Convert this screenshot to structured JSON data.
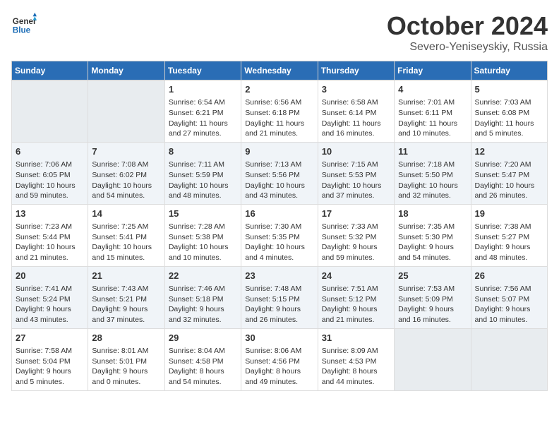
{
  "header": {
    "logo_line1": "General",
    "logo_line2": "Blue",
    "month": "October 2024",
    "location": "Severo-Yeniseyskiy, Russia"
  },
  "columns": [
    "Sunday",
    "Monday",
    "Tuesday",
    "Wednesday",
    "Thursday",
    "Friday",
    "Saturday"
  ],
  "weeks": [
    {
      "days": [
        {
          "number": "",
          "info": ""
        },
        {
          "number": "",
          "info": ""
        },
        {
          "number": "1",
          "info": "Sunrise: 6:54 AM\nSunset: 6:21 PM\nDaylight: 11 hours\nand 27 minutes."
        },
        {
          "number": "2",
          "info": "Sunrise: 6:56 AM\nSunset: 6:18 PM\nDaylight: 11 hours\nand 21 minutes."
        },
        {
          "number": "3",
          "info": "Sunrise: 6:58 AM\nSunset: 6:14 PM\nDaylight: 11 hours\nand 16 minutes."
        },
        {
          "number": "4",
          "info": "Sunrise: 7:01 AM\nSunset: 6:11 PM\nDaylight: 11 hours\nand 10 minutes."
        },
        {
          "number": "5",
          "info": "Sunrise: 7:03 AM\nSunset: 6:08 PM\nDaylight: 11 hours\nand 5 minutes."
        }
      ]
    },
    {
      "days": [
        {
          "number": "6",
          "info": "Sunrise: 7:06 AM\nSunset: 6:05 PM\nDaylight: 10 hours\nand 59 minutes."
        },
        {
          "number": "7",
          "info": "Sunrise: 7:08 AM\nSunset: 6:02 PM\nDaylight: 10 hours\nand 54 minutes."
        },
        {
          "number": "8",
          "info": "Sunrise: 7:11 AM\nSunset: 5:59 PM\nDaylight: 10 hours\nand 48 minutes."
        },
        {
          "number": "9",
          "info": "Sunrise: 7:13 AM\nSunset: 5:56 PM\nDaylight: 10 hours\nand 43 minutes."
        },
        {
          "number": "10",
          "info": "Sunrise: 7:15 AM\nSunset: 5:53 PM\nDaylight: 10 hours\nand 37 minutes."
        },
        {
          "number": "11",
          "info": "Sunrise: 7:18 AM\nSunset: 5:50 PM\nDaylight: 10 hours\nand 32 minutes."
        },
        {
          "number": "12",
          "info": "Sunrise: 7:20 AM\nSunset: 5:47 PM\nDaylight: 10 hours\nand 26 minutes."
        }
      ]
    },
    {
      "days": [
        {
          "number": "13",
          "info": "Sunrise: 7:23 AM\nSunset: 5:44 PM\nDaylight: 10 hours\nand 21 minutes."
        },
        {
          "number": "14",
          "info": "Sunrise: 7:25 AM\nSunset: 5:41 PM\nDaylight: 10 hours\nand 15 minutes."
        },
        {
          "number": "15",
          "info": "Sunrise: 7:28 AM\nSunset: 5:38 PM\nDaylight: 10 hours\nand 10 minutes."
        },
        {
          "number": "16",
          "info": "Sunrise: 7:30 AM\nSunset: 5:35 PM\nDaylight: 10 hours\nand 4 minutes."
        },
        {
          "number": "17",
          "info": "Sunrise: 7:33 AM\nSunset: 5:32 PM\nDaylight: 9 hours\nand 59 minutes."
        },
        {
          "number": "18",
          "info": "Sunrise: 7:35 AM\nSunset: 5:30 PM\nDaylight: 9 hours\nand 54 minutes."
        },
        {
          "number": "19",
          "info": "Sunrise: 7:38 AM\nSunset: 5:27 PM\nDaylight: 9 hours\nand 48 minutes."
        }
      ]
    },
    {
      "days": [
        {
          "number": "20",
          "info": "Sunrise: 7:41 AM\nSunset: 5:24 PM\nDaylight: 9 hours\nand 43 minutes."
        },
        {
          "number": "21",
          "info": "Sunrise: 7:43 AM\nSunset: 5:21 PM\nDaylight: 9 hours\nand 37 minutes."
        },
        {
          "number": "22",
          "info": "Sunrise: 7:46 AM\nSunset: 5:18 PM\nDaylight: 9 hours\nand 32 minutes."
        },
        {
          "number": "23",
          "info": "Sunrise: 7:48 AM\nSunset: 5:15 PM\nDaylight: 9 hours\nand 26 minutes."
        },
        {
          "number": "24",
          "info": "Sunrise: 7:51 AM\nSunset: 5:12 PM\nDaylight: 9 hours\nand 21 minutes."
        },
        {
          "number": "25",
          "info": "Sunrise: 7:53 AM\nSunset: 5:09 PM\nDaylight: 9 hours\nand 16 minutes."
        },
        {
          "number": "26",
          "info": "Sunrise: 7:56 AM\nSunset: 5:07 PM\nDaylight: 9 hours\nand 10 minutes."
        }
      ]
    },
    {
      "days": [
        {
          "number": "27",
          "info": "Sunrise: 7:58 AM\nSunset: 5:04 PM\nDaylight: 9 hours\nand 5 minutes."
        },
        {
          "number": "28",
          "info": "Sunrise: 8:01 AM\nSunset: 5:01 PM\nDaylight: 9 hours\nand 0 minutes."
        },
        {
          "number": "29",
          "info": "Sunrise: 8:04 AM\nSunset: 4:58 PM\nDaylight: 8 hours\nand 54 minutes."
        },
        {
          "number": "30",
          "info": "Sunrise: 8:06 AM\nSunset: 4:56 PM\nDaylight: 8 hours\nand 49 minutes."
        },
        {
          "number": "31",
          "info": "Sunrise: 8:09 AM\nSunset: 4:53 PM\nDaylight: 8 hours\nand 44 minutes."
        },
        {
          "number": "",
          "info": ""
        },
        {
          "number": "",
          "info": ""
        }
      ]
    }
  ]
}
